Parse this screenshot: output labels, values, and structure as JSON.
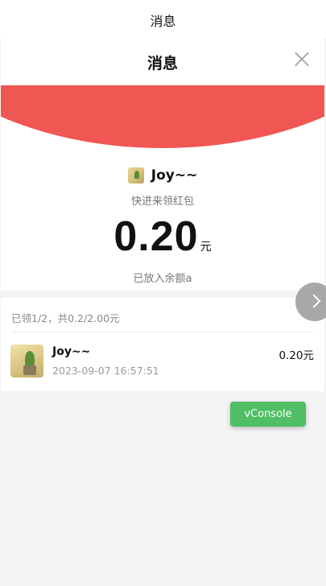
{
  "system_bar": {
    "title": "消息"
  },
  "sheet": {
    "title": "消息",
    "sender": {
      "name": "Joy~~",
      "greeting": "快进来领红包"
    },
    "amount": {
      "value": "0.20",
      "unit": "元"
    },
    "deposit_note": "已放入余额a",
    "summary": "已领1/2，共0.2/2.00元",
    "receivers": [
      {
        "name": "Joy~~",
        "time": "2023-09-07 16:57:51",
        "amount": "0.20元"
      }
    ]
  },
  "vconsole": {
    "label": "vConsole"
  },
  "icons": {
    "close": "close-icon",
    "next": "chevron-right-icon",
    "avatar": "user-avatar"
  },
  "colors": {
    "red_banner": "#f05652",
    "vconsole_green": "#4fbe64"
  }
}
